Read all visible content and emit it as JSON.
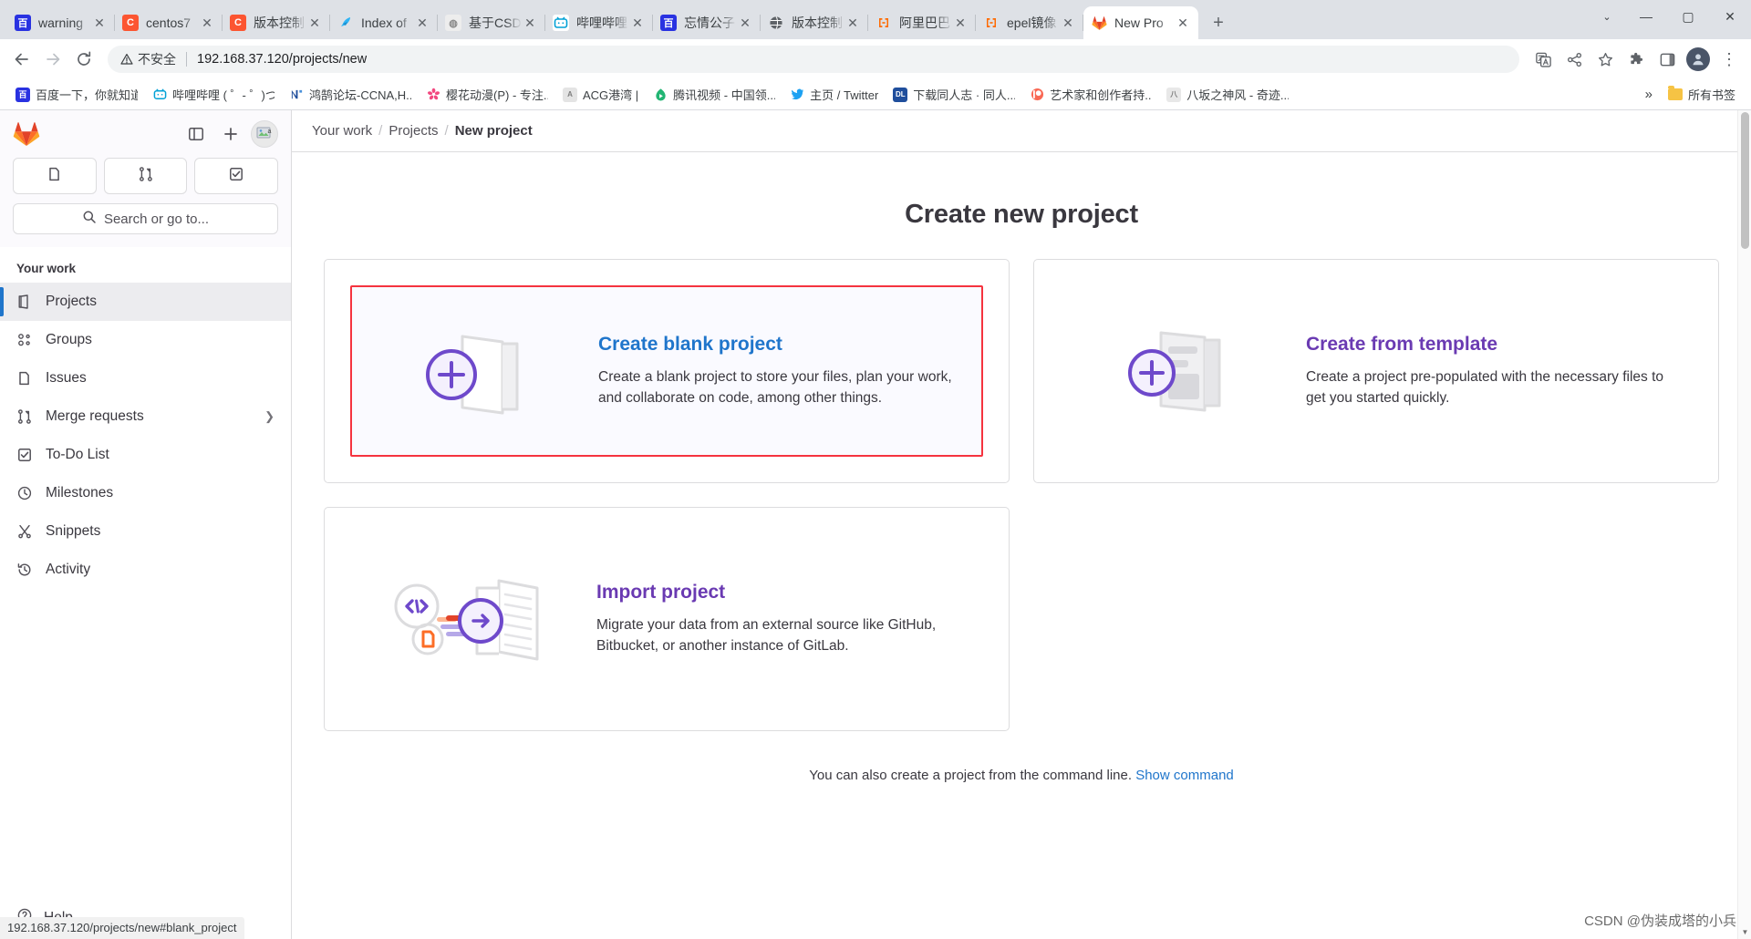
{
  "browser": {
    "tabs": [
      {
        "title": "warning",
        "favicon": "baidu-icon",
        "color": "#2932e1",
        "letter": "百",
        "active": false
      },
      {
        "title": "centos7",
        "favicon": "csdn-icon",
        "color": "#fc5531",
        "letter": "C",
        "active": false
      },
      {
        "title": "版本控制",
        "favicon": "csdn-icon",
        "color": "#fc5531",
        "letter": "C",
        "active": false
      },
      {
        "title": "Index of",
        "favicon": "bird-icon",
        "color": "#1aa3ff",
        "letter": "",
        "active": false
      },
      {
        "title": "基于CSD",
        "favicon": "page-icon",
        "color": "#e8e8e8",
        "letter": "",
        "active": false
      },
      {
        "title": "哔哩哔哩",
        "favicon": "bilibili-icon",
        "color": "#00a1d6",
        "letter": "",
        "active": false
      },
      {
        "title": "忘情公子",
        "favicon": "baidu-icon",
        "color": "#2932e1",
        "letter": "百",
        "active": false
      },
      {
        "title": "版本控制",
        "favicon": "globe-icon",
        "color": "#5f6368",
        "letter": "",
        "active": false
      },
      {
        "title": "阿里巴巴",
        "favicon": "aliyun-icon",
        "color": "#ff6a00",
        "letter": "",
        "active": false
      },
      {
        "title": "epel镜像",
        "favicon": "aliyun-icon",
        "color": "#ff6a00",
        "letter": "",
        "active": false
      },
      {
        "title": "New Pro",
        "favicon": "gitlab-icon",
        "color": "#fc6d26",
        "letter": "",
        "active": true
      }
    ],
    "new_tab_label": "+",
    "window_controls": {
      "chevron": "⌄",
      "minimize": "—",
      "maximize": "▢",
      "close": "✕"
    },
    "toolbar": {
      "back": "back-arrow",
      "forward": "forward-arrow",
      "reload": "reload",
      "security_label": "不安全",
      "url": "192.168.37.120/projects/new",
      "translate": "translate-icon",
      "share": "share-icon",
      "bookmark_star": "☆",
      "extensions": "extensions-icon",
      "sidepanel": "side-panel-icon",
      "profile": "profile-avatar",
      "menu": "⋮"
    },
    "bookmarks": [
      {
        "label": "百度一下，你就知道",
        "color": "#2932e1",
        "letter": "百"
      },
      {
        "label": "哔哩哔哩 ( ゜- ゜)つ...",
        "color": "#00a1d6",
        "letter": "b"
      },
      {
        "label": "鸿鹄论坛-CCNA,H...",
        "color": "#1f4e9c",
        "letter": "N"
      },
      {
        "label": "樱花动漫(P) - 专注...",
        "color": "#f472b6",
        "letter": "樱"
      },
      {
        "label": "ACG港湾 |",
        "color": "#9aa0a6",
        "letter": "A"
      },
      {
        "label": "腾讯视频 - 中国领...",
        "color": "#19b36b",
        "letter": "腾"
      },
      {
        "label": "主页 / Twitter",
        "color": "#1da1f2",
        "letter": "t"
      },
      {
        "label": "下载同人志 · 同人...",
        "color": "#1f4e9c",
        "letter": "DL"
      },
      {
        "label": "艺术家和创作者持...",
        "color": "#e8590c",
        "letter": "P"
      },
      {
        "label": "八坂之神风 - 奇迹...",
        "color": "#f6c344",
        "letter": "八"
      }
    ],
    "bookmarks_overflow": "»",
    "all_bookmarks_label": "所有书签",
    "status_bubble": "192.168.37.120/projects/new#blank_project"
  },
  "gitlab": {
    "sidebar": {
      "logo": "gitlab-logo",
      "toggle_sidebar": "sidebar-toggle-icon",
      "create_new": "+",
      "user_avatar": "user-avatar",
      "quick_actions": [
        {
          "name": "issues-shortcut",
          "icon": "issue-icon"
        },
        {
          "name": "merge-requests-shortcut",
          "icon": "merge-request-icon"
        },
        {
          "name": "todo-shortcut",
          "icon": "todo-icon"
        }
      ],
      "search_placeholder": "Search or go to...",
      "section_title": "Your work",
      "items": [
        {
          "label": "Projects",
          "icon": "project-icon",
          "active": true,
          "chevron": false
        },
        {
          "label": "Groups",
          "icon": "group-icon",
          "active": false,
          "chevron": false
        },
        {
          "label": "Issues",
          "icon": "issue-icon",
          "active": false,
          "chevron": false
        },
        {
          "label": "Merge requests",
          "icon": "merge-request-icon",
          "active": false,
          "chevron": true
        },
        {
          "label": "To-Do List",
          "icon": "todo-icon",
          "active": false,
          "chevron": false
        },
        {
          "label": "Milestones",
          "icon": "milestone-icon",
          "active": false,
          "chevron": false
        },
        {
          "label": "Snippets",
          "icon": "snippet-icon",
          "active": false,
          "chevron": false
        },
        {
          "label": "Activity",
          "icon": "activity-icon",
          "active": false,
          "chevron": false
        }
      ],
      "help_label": "Help",
      "help_icon": "help-icon"
    },
    "breadcrumb": {
      "item1": "Your work",
      "sep1": "/",
      "item2": "Projects",
      "sep2": "/",
      "current": "New project"
    },
    "page_title": "Create new project",
    "cards": [
      {
        "title": "Create blank project",
        "desc": "Create a blank project to store your files, plan your work, and collaborate on code, among other things.",
        "illustration": "blank-project-illustration",
        "title_color": "blue",
        "highlighted": true
      },
      {
        "title": "Create from template",
        "desc": "Create a project pre-populated with the necessary files to get you started quickly.",
        "illustration": "template-project-illustration",
        "title_color": "purple",
        "highlighted": false
      },
      {
        "title": "Import project",
        "desc": "Migrate your data from an external source like GitHub, Bitbucket, or another instance of GitLab.",
        "illustration": "import-project-illustration",
        "title_color": "purple",
        "highlighted": false
      }
    ],
    "footer": {
      "text": "You can also create a project from the command line.",
      "link": "Show command"
    }
  },
  "watermark": "CSDN @伪装成塔的小兵",
  "colors": {
    "highlight_border": "#f5333f",
    "link_blue": "#1f75cb",
    "gitlab_purple": "#6a3ab2",
    "active_indicator": "#1f75cb"
  }
}
